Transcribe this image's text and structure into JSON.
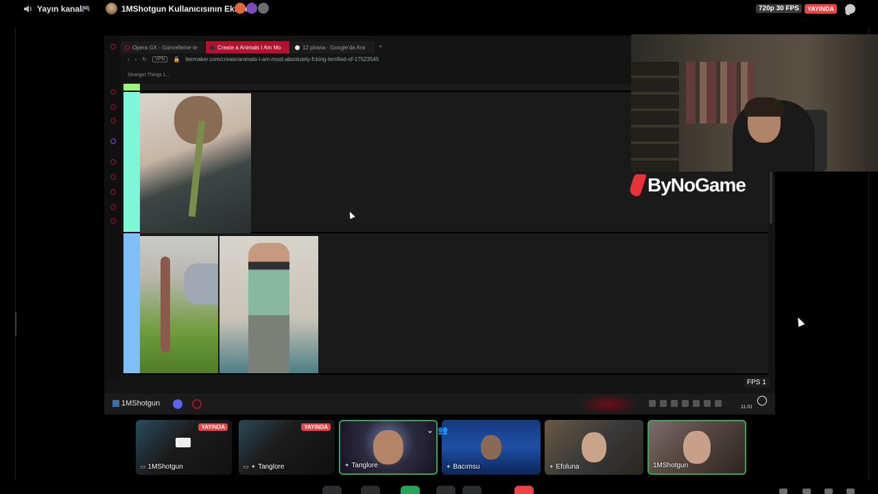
{
  "topbar": {
    "channel": "Yayın kanalı",
    "title": "1MShotgun Kullanıcısının Ekranı",
    "quality": "720p 30 FPS",
    "live_badge": "YAYINDA"
  },
  "browser": {
    "tabs": [
      {
        "label": "Opera GX - Güncelleme te",
        "active": false
      },
      {
        "label": "Create a Animals I Am Mo",
        "active": true
      },
      {
        "label": "12 pirana - Google'da Ara",
        "active": false
      }
    ],
    "vpn": "VPN",
    "url": "tiermaker.com/create/animals-i-am-most-absolutely-fcking-terrified-of-17523545",
    "bookmark": "Stranger Things 1..."
  },
  "stream": {
    "fps": "FPS 1",
    "taskbar_user": "1MShotgun",
    "clock": "11.01"
  },
  "overlay": {
    "brand": "ByNoGame"
  },
  "participants": [
    {
      "name": "1MShotgun",
      "live": "YAYINDA",
      "speaking": false
    },
    {
      "name": "Tanglore",
      "live": "YAYINDA",
      "speaking": false
    },
    {
      "name": "Tanglore",
      "live": "",
      "speaking": true
    },
    {
      "name": "Bacımsu",
      "live": "",
      "speaking": false
    },
    {
      "name": "Efoluna",
      "live": "",
      "speaking": false
    },
    {
      "name": "1MShotgun",
      "live": "",
      "speaking": true
    }
  ],
  "colors": {
    "accent": "#ed4245",
    "speaking": "#3ba55c",
    "opera": "#b2122e"
  }
}
